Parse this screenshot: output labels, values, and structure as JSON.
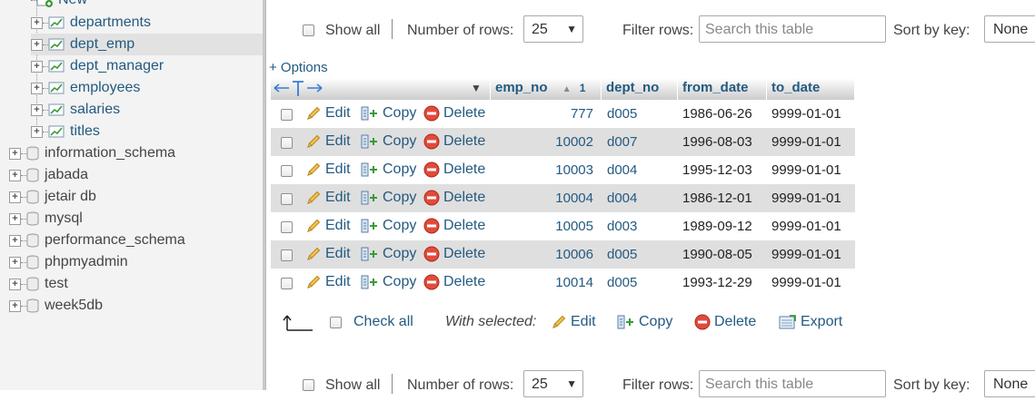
{
  "sidebar": {
    "new_label": "New",
    "tables": [
      {
        "label": "departments",
        "selected": false
      },
      {
        "label": "dept_emp",
        "selected": true
      },
      {
        "label": "dept_manager",
        "selected": false
      },
      {
        "label": "employees",
        "selected": false
      },
      {
        "label": "salaries",
        "selected": false
      },
      {
        "label": "titles",
        "selected": false
      }
    ],
    "databases": [
      {
        "label": "information_schema"
      },
      {
        "label": "jabada"
      },
      {
        "label": "jetair db"
      },
      {
        "label": "mysql"
      },
      {
        "label": "performance_schema"
      },
      {
        "label": "phpmyadmin"
      },
      {
        "label": "test"
      },
      {
        "label": "week5db"
      }
    ]
  },
  "nav": {
    "show_all_label": "Show all",
    "rows_label": "Number of rows:",
    "rows_value": "25",
    "filter_label": "Filter rows:",
    "filter_placeholder": "Search this table",
    "sort_label": "Sort by key:",
    "sort_value": "None"
  },
  "options_label": "+ Options",
  "table": {
    "columns": [
      {
        "label": "emp_no",
        "sort_indicator": "1"
      },
      {
        "label": "dept_no"
      },
      {
        "label": "from_date"
      },
      {
        "label": "to_date"
      }
    ],
    "action_labels": {
      "edit": "Edit",
      "copy": "Copy",
      "delete": "Delete"
    },
    "rows": [
      {
        "emp_no": "777",
        "dept_no": "d005",
        "from_date": "1986-06-26",
        "to_date": "9999-01-01"
      },
      {
        "emp_no": "10002",
        "dept_no": "d007",
        "from_date": "1996-08-03",
        "to_date": "9999-01-01"
      },
      {
        "emp_no": "10003",
        "dept_no": "d004",
        "from_date": "1995-12-03",
        "to_date": "9999-01-01"
      },
      {
        "emp_no": "10004",
        "dept_no": "d004",
        "from_date": "1986-12-01",
        "to_date": "9999-01-01"
      },
      {
        "emp_no": "10005",
        "dept_no": "d003",
        "from_date": "1989-09-12",
        "to_date": "9999-01-01"
      },
      {
        "emp_no": "10006",
        "dept_no": "d005",
        "from_date": "1990-08-05",
        "to_date": "9999-01-01"
      },
      {
        "emp_no": "10014",
        "dept_no": "d005",
        "from_date": "1993-12-29",
        "to_date": "9999-01-01"
      }
    ]
  },
  "bulk": {
    "check_all": "Check all",
    "with_selected": "With selected:",
    "edit": "Edit",
    "copy": "Copy",
    "delete": "Delete",
    "export": "Export"
  },
  "colors": {
    "link": "#235a81",
    "row_alt": "#dfdfdf",
    "sidebar_bg": "#f3f3f3"
  }
}
